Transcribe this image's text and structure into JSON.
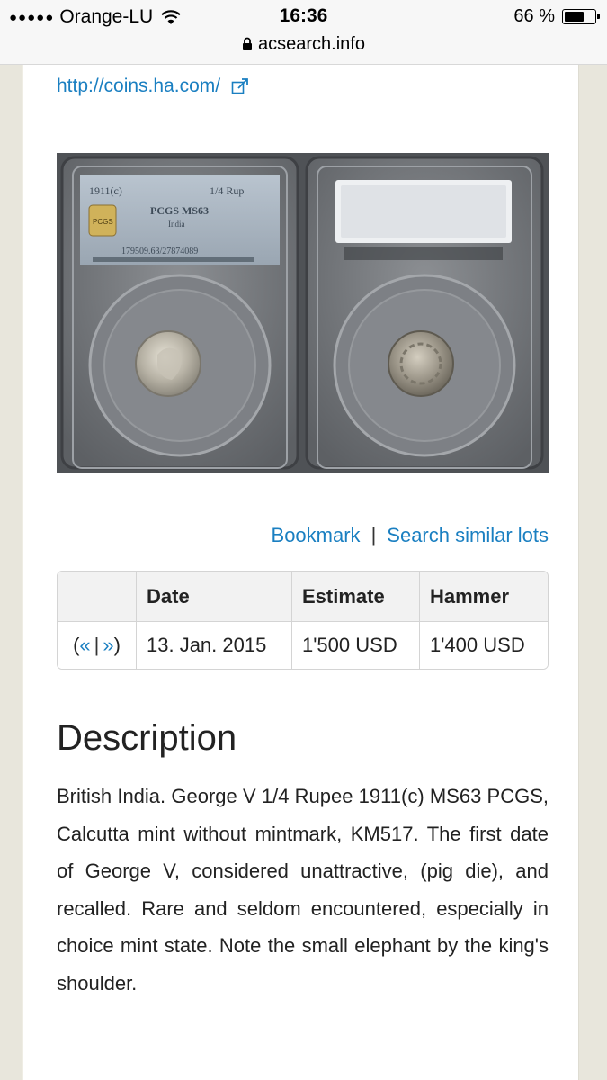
{
  "status_bar": {
    "carrier": "Orange-LU",
    "time": "16:36",
    "battery": "66 %",
    "battery_level": 0.66,
    "url": "acsearch.info"
  },
  "page": {
    "external_link": "http://coins.ha.com/",
    "coin_image": {
      "slab_left_label": [
        "1911(c)",
        "1/4 Rup",
        "PCGS MS63",
        "India",
        "179509.63/27874089"
      ],
      "grader_logo": "PCGS"
    },
    "actions": {
      "bookmark": "Bookmark",
      "separator": "|",
      "search_similar": "Search similar lots"
    },
    "table": {
      "headers": [
        "",
        "Date",
        "Estimate",
        "Hammer"
      ],
      "nav": {
        "open": "(",
        "prev": "«",
        "bar": "|",
        "next": "»",
        "close": ")"
      },
      "row": {
        "date": "13. Jan. 2015",
        "estimate": "1'500 USD",
        "hammer": "1'400 USD"
      }
    },
    "description": {
      "title": "Description",
      "text": "British India. George V 1/4 Rupee 1911(c) MS63 PCGS, Calcutta mint without mintmark, KM517. The first date of George V, considered unattractive, (pig die), and recalled. Rare and seldom encountered, especially in choice mint state. Note the small elephant by the king's shoulder."
    }
  },
  "colors": {
    "link": "#1a7fc1",
    "page_bg": "#efede4",
    "text": "#222222"
  }
}
